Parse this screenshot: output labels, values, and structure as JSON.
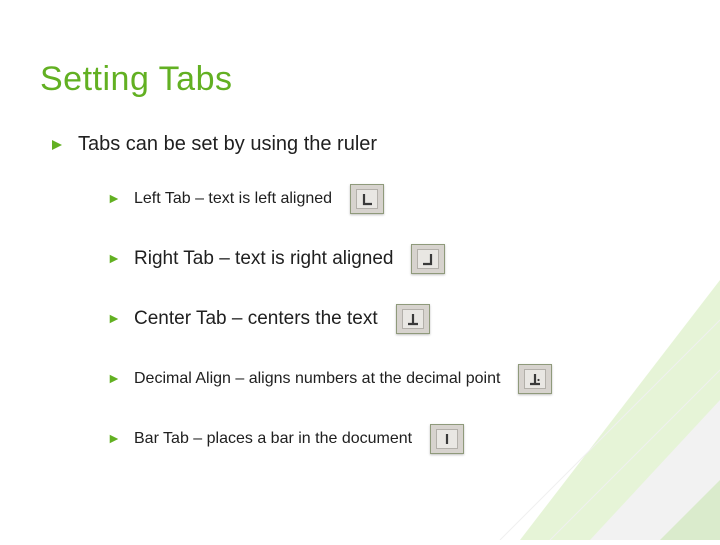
{
  "title": "Setting Tabs",
  "main_point": "Tabs can be set by using the ruler",
  "items": [
    {
      "text": "Left Tab – text is left aligned",
      "icon": "left-tab-icon",
      "size": "small"
    },
    {
      "text": "Right Tab – text is right aligned",
      "icon": "right-tab-icon",
      "size": "large"
    },
    {
      "text": "Center Tab – centers the text",
      "icon": "center-tab-icon",
      "size": "large"
    },
    {
      "text": "Decimal Align – aligns numbers at the decimal point",
      "icon": "decimal-tab-icon",
      "size": "small"
    },
    {
      "text": "Bar Tab – places a bar in the document",
      "icon": "bar-tab-icon",
      "size": "small"
    }
  ],
  "colors": {
    "accent": "#62b022"
  }
}
